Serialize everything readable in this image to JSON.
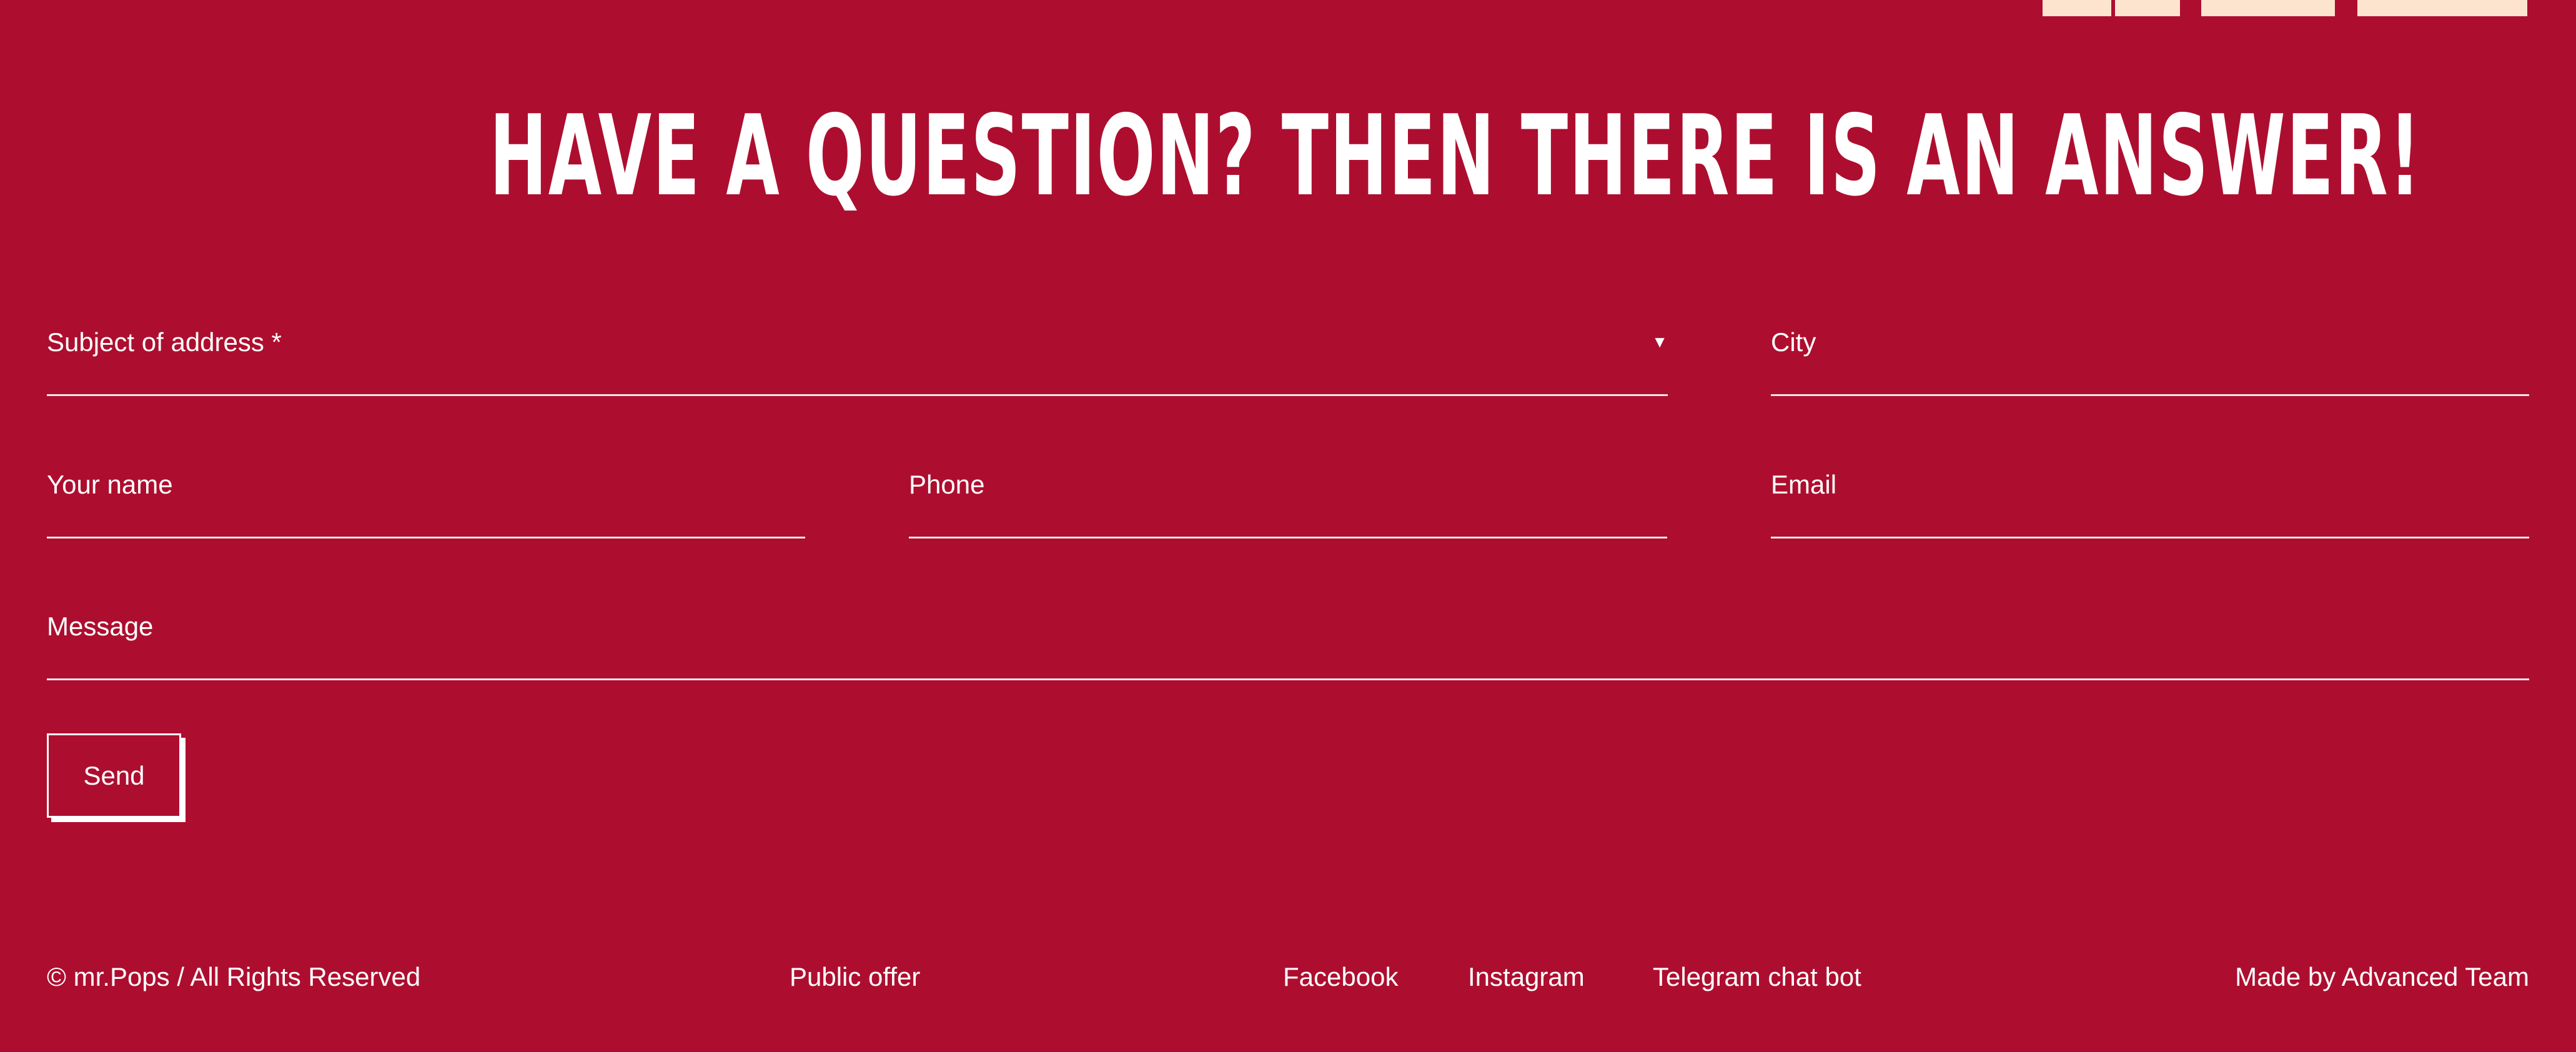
{
  "heading": "HAVE A QUESTION? THEN THERE IS AN ANSWER!",
  "form": {
    "subject_label": "Subject of address *",
    "subject_arrow": "▼",
    "city_label": "City",
    "name_label": "Your name",
    "phone_label": "Phone",
    "email_label": "Email",
    "message_label": "Message",
    "send_label": "Send"
  },
  "footer": {
    "copyright": "© mr.Pops / All Rights Reserved",
    "public_offer": "Public offer",
    "facebook": "Facebook",
    "instagram": "Instagram",
    "telegram": "Telegram chat bot",
    "made_by": "Made by Advanced Team"
  },
  "colors": {
    "background": "#ad0e2f",
    "text": "#ffffff",
    "top_tabs": "#fde4cf"
  }
}
